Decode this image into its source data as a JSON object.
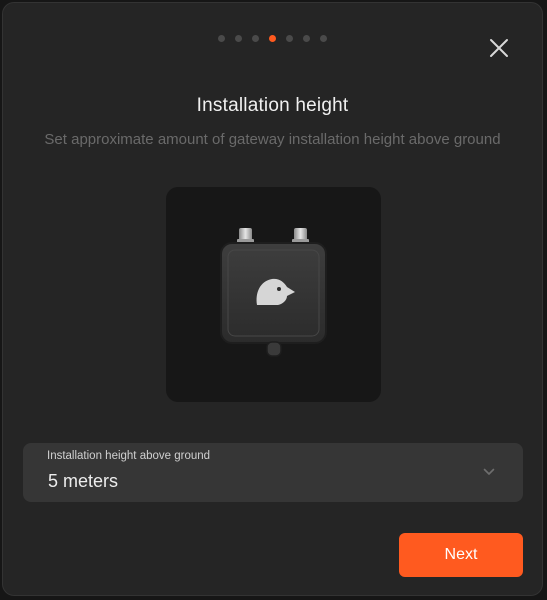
{
  "stepper": {
    "total_steps": 7,
    "current_step": 4,
    "active_color": "#ff5a1f",
    "inactive_color": "#4a4a4a"
  },
  "header": {
    "close_icon": "close-icon",
    "title": "Installation height",
    "subtitle": "Set approximate amount of gateway installation height above ground"
  },
  "illustration": {
    "icon": "gateway-device-icon"
  },
  "height_select": {
    "label": "Installation height above ground",
    "value": "5 meters",
    "icon": "chevron-down-icon"
  },
  "footer": {
    "next_label": "Next",
    "accent_color": "#ff5a1f"
  }
}
